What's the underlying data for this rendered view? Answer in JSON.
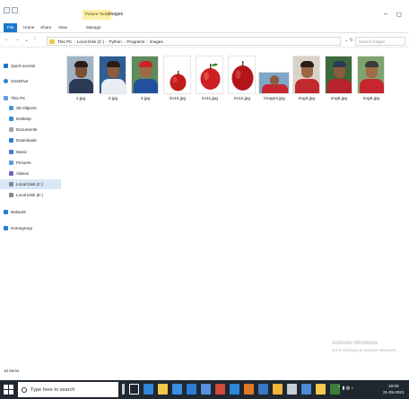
{
  "window": {
    "context_tab": "Picture Tools",
    "title": "images",
    "minimize": "–",
    "maximize": "◻"
  },
  "ribbon": {
    "tabs": [
      "File",
      "Home",
      "Share",
      "View",
      "Manage"
    ]
  },
  "address": {
    "crumbs": [
      "This PC",
      "Local Disk (C:)",
      "Python",
      "Programs",
      "images"
    ],
    "search_placeholder": "Search images",
    "nav_glyphs": [
      "←",
      "→",
      "⌄",
      "↑"
    ]
  },
  "nav_pane": {
    "items": [
      {
        "label": "Quick access",
        "icon": "star-icon",
        "color": "#1e73c8"
      },
      {
        "label": "OneDrive",
        "icon": "cloud-icon",
        "color": "#2a7fd4"
      },
      {
        "label": "This PC",
        "icon": "computer-icon",
        "color": "#5aa0dc"
      },
      {
        "label": "3D Objects",
        "icon": "cube-icon",
        "color": "#4e9bd6"
      },
      {
        "label": "Desktop",
        "icon": "desktop-icon",
        "color": "#3d8ed0"
      },
      {
        "label": "Documents",
        "icon": "document-icon",
        "color": "#9aa6b2"
      },
      {
        "label": "Downloads",
        "icon": "download-icon",
        "color": "#2a7fd4"
      },
      {
        "label": "Music",
        "icon": "music-icon",
        "color": "#3b7dd8"
      },
      {
        "label": "Pictures",
        "icon": "pictures-icon",
        "color": "#5aa0dc"
      },
      {
        "label": "Videos",
        "icon": "video-icon",
        "color": "#7b5bc9"
      },
      {
        "label": "Local Disk (C:)",
        "icon": "drive-icon",
        "color": "#7f8a94"
      },
      {
        "label": "Local Disk (E:)",
        "icon": "drive-icon",
        "color": "#7f8a94"
      },
      {
        "label": "Network",
        "icon": "network-icon",
        "color": "#2a7fd4"
      },
      {
        "label": "Homegroup",
        "icon": "homegroup-icon",
        "color": "#2a7fd4"
      }
    ],
    "selected": "Local Disk (C:)"
  },
  "files": [
    {
      "name": "1.jpg",
      "kind": "person"
    },
    {
      "name": "2.jpg",
      "kind": "person"
    },
    {
      "name": "4.jpg",
      "kind": "person"
    },
    {
      "name": "im10.jpg",
      "kind": "apple"
    },
    {
      "name": "im11.jpg",
      "kind": "apple"
    },
    {
      "name": "im12.jpg",
      "kind": "apple"
    },
    {
      "name": "image2.jpg",
      "kind": "person"
    },
    {
      "name": "img3.jpg",
      "kind": "person"
    },
    {
      "name": "img6.jpg",
      "kind": "person"
    },
    {
      "name": "img9.jpg",
      "kind": "person"
    }
  ],
  "status": {
    "item_count": "10 items"
  },
  "watermark": {
    "line1": "Activate Windows",
    "line2": "Go to Settings to activate Windows."
  },
  "taskbar": {
    "search_placeholder": "Type here to search",
    "time": "19:00",
    "date": "21-09-2021",
    "accent": "#1f2730"
  }
}
